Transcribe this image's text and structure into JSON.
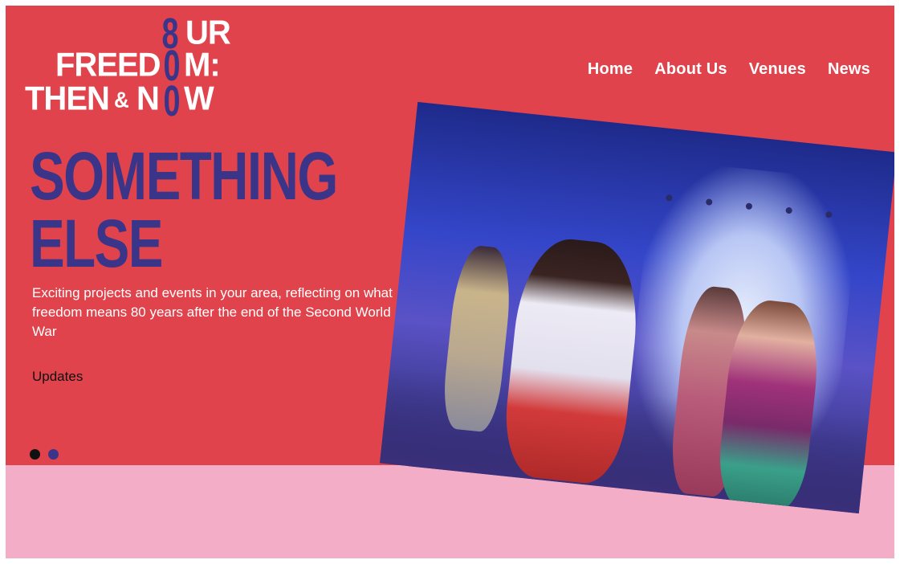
{
  "logo": {
    "line1_a": "",
    "line1_b": "UR",
    "line2_a": "FREED",
    "line2_b": "M:",
    "line3_a": "THEN",
    "line3_amp": "&",
    "line3_b": "N",
    "line3_c": "W",
    "eight": "80"
  },
  "nav": {
    "items": [
      "Home",
      "About Us",
      "Venues",
      "News"
    ]
  },
  "hero": {
    "headline_line1": "SOMETHING",
    "headline_line2": "ELSE",
    "intro": "Exciting projects and events in your area, reflecting on what freedom means 80 years after the end of the Second World War",
    "updates_link": "Updates",
    "slider": {
      "total": 2,
      "active": 1
    }
  },
  "colors": {
    "hero_bg": "#e0434c",
    "lower_bg": "#f4adc7",
    "brand_navy": "#3b3589",
    "text_white": "#ffffff",
    "dot_active": "#111111",
    "dot_inactive": "#3b3589"
  }
}
